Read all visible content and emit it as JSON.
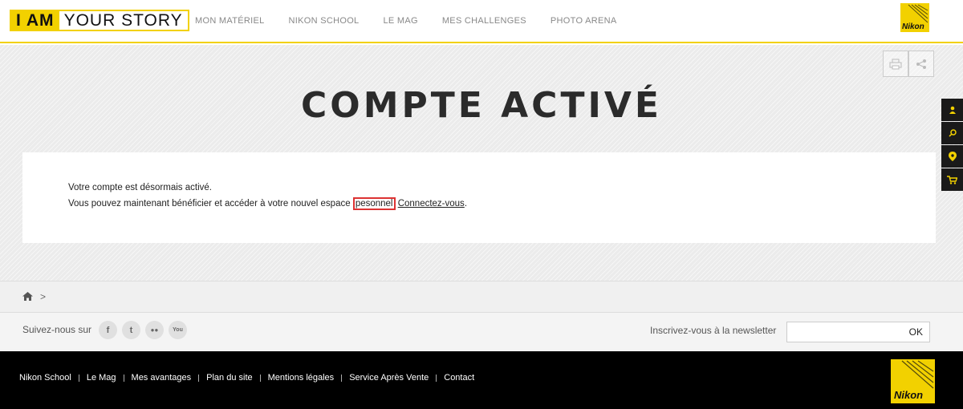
{
  "header": {
    "logo_iam": "I AM",
    "logo_story": "YOUR STORY",
    "nav": [
      "MON MATÉRIEL",
      "NIKON SCHOOL",
      "LE MAG",
      "MES CHALLENGES",
      "PHOTO ARENA"
    ],
    "brand": "Nikon"
  },
  "main": {
    "title": "COMPTE ACTIVÉ",
    "line1": "Votre compte est désormais activé.",
    "line2_prefix": "Vous pouvez maintenant bénéficier et accéder à votre nouvel espace ",
    "line2_highlight": "pesonnel",
    "line2_link": "Connectez-vous",
    "line2_suffix": "."
  },
  "breadcrumb": {
    "sep": ">"
  },
  "social": {
    "follow_label": "Suivez-nous sur",
    "icons": [
      "f",
      "t",
      "●●",
      "You"
    ],
    "newsletter_label": "Inscrivez-vous à la newsletter",
    "ok_label": "OK"
  },
  "footer": {
    "links": [
      "Nikon School",
      "Le Mag",
      "Mes avantages",
      "Plan du site",
      "Mentions légales",
      "Service Après Vente",
      "Contact"
    ],
    "brand": "Nikon"
  },
  "colors": {
    "accent": "#f2d100",
    "highlight_border": "#dd3333"
  }
}
